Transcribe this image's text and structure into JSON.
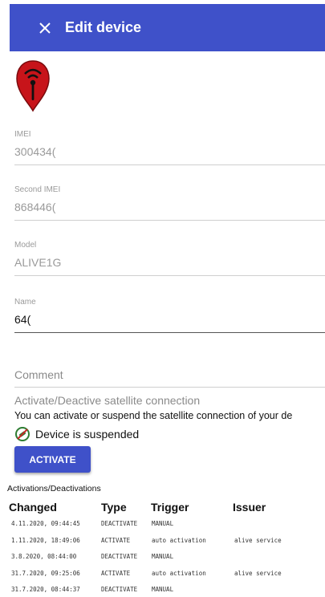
{
  "header": {
    "title": "Edit device",
    "bg_color": "#3f51c9"
  },
  "device": {
    "icon": "red-pin-tracker-icon"
  },
  "fields": {
    "imei": {
      "label": "IMEI",
      "value": "300434("
    },
    "second_imei": {
      "label": "Second IMEI",
      "value": "868446("
    },
    "model": {
      "label": "Model",
      "value": "ALIVE1G"
    },
    "name": {
      "label": "Name",
      "value": "64("
    },
    "comment": {
      "placeholder": "Comment"
    }
  },
  "satellite": {
    "title": "Activate/Deactive satellite connection",
    "description": "You can activate or suspend the satellite connection of your de",
    "status": "Device is suspended",
    "button_label": "ACTIVATE"
  },
  "history": {
    "title": "Activations/Deactivations",
    "columns": [
      "Changed",
      "Type",
      "Trigger",
      "Issuer"
    ],
    "rows": [
      [
        "4.11.2020, 09:44:45",
        "DEACTIVATE",
        "MANUAL",
        ""
      ],
      [
        "1.11.2020, 18:49:06",
        "ACTIVATE",
        "auto activation",
        "alive service"
      ],
      [
        "3.8.2020, 08:44:00",
        "DEACTIVATE",
        "MANUAL",
        ""
      ],
      [
        "31.7.2020, 09:25:06",
        "ACTIVATE",
        "auto activation",
        "alive service"
      ],
      [
        "31.7.2020, 08:44:37",
        "DEACTIVATE",
        "MANUAL",
        ""
      ]
    ]
  }
}
